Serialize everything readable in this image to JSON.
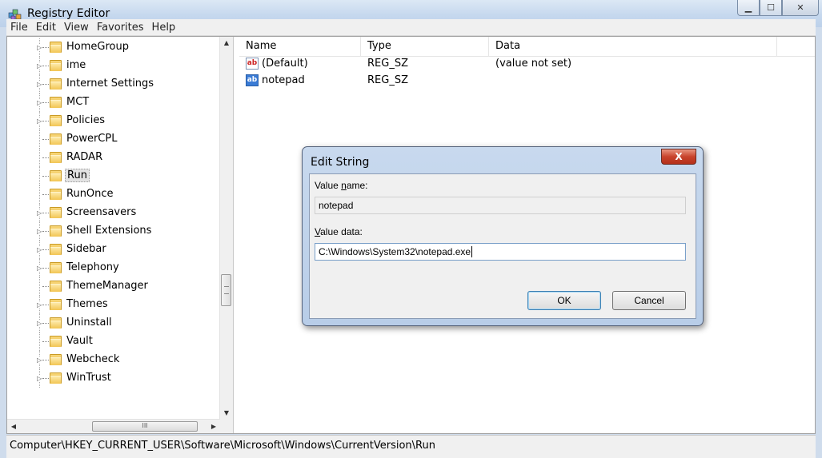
{
  "window": {
    "title": "Registry Editor",
    "controls": {
      "minimize": "▁",
      "maximize": "☐",
      "close": "✕"
    }
  },
  "menu": [
    "File",
    "Edit",
    "View",
    "Favorites",
    "Help"
  ],
  "tree": {
    "items": [
      {
        "label": "HomeGroup",
        "expandable": true
      },
      {
        "label": "ime",
        "expandable": true
      },
      {
        "label": "Internet Settings",
        "expandable": true
      },
      {
        "label": "MCT",
        "expandable": true
      },
      {
        "label": "Policies",
        "expandable": true
      },
      {
        "label": "PowerCPL",
        "expandable": false
      },
      {
        "label": "RADAR",
        "expandable": false
      },
      {
        "label": "Run",
        "expandable": false,
        "selected": true
      },
      {
        "label": "RunOnce",
        "expandable": false
      },
      {
        "label": "Screensavers",
        "expandable": true
      },
      {
        "label": "Shell Extensions",
        "expandable": true
      },
      {
        "label": "Sidebar",
        "expandable": true
      },
      {
        "label": "Telephony",
        "expandable": true
      },
      {
        "label": "ThemeManager",
        "expandable": false
      },
      {
        "label": "Themes",
        "expandable": true
      },
      {
        "label": "Uninstall",
        "expandable": true
      },
      {
        "label": "Vault",
        "expandable": false
      },
      {
        "label": "Webcheck",
        "expandable": true
      },
      {
        "label": "WinTrust",
        "expandable": true
      }
    ],
    "hscroll_grip": "III"
  },
  "list": {
    "columns": {
      "name": "Name",
      "type": "Type",
      "data": "Data"
    },
    "rows": [
      {
        "name": "(Default)",
        "type": "REG_SZ",
        "data": "(value not set)"
      },
      {
        "name": "notepad",
        "type": "REG_SZ",
        "data": ""
      }
    ],
    "icon_text": "ab"
  },
  "dialog": {
    "title": "Edit String",
    "close_label": "X",
    "value_name_label_pre": "Value ",
    "value_name_label_u": "n",
    "value_name_label_post": "ame:",
    "value_name": "notepad",
    "value_data_label_u": "V",
    "value_data_label_post": "alue data:",
    "value_data": "C:\\Windows\\System32\\notepad.exe",
    "ok_label": "OK",
    "cancel_label": "Cancel"
  },
  "status": {
    "path": "Computer\\HKEY_CURRENT_USER\\Software\\Microsoft\\Windows\\CurrentVersion\\Run"
  }
}
